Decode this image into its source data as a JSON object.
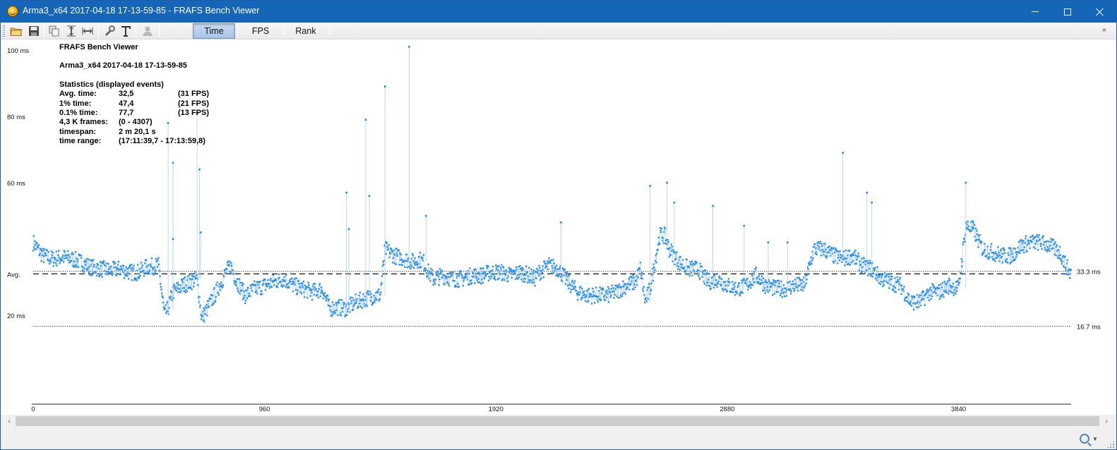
{
  "window": {
    "title": "Arma3_x64 2017-04-18 17-13-59-85 - FRAFS Bench Viewer"
  },
  "toolbar": {
    "icons": [
      "open-folder-icon",
      "save-icon",
      "copy-icon",
      "fit-vertical-icon",
      "fit-horizontal-icon",
      "settings-wrench-icon",
      "text-icon",
      "user-icon"
    ],
    "tabs": [
      {
        "label": "Time",
        "active": true
      },
      {
        "label": "FPS",
        "active": false
      },
      {
        "label": "Rank",
        "active": false
      }
    ]
  },
  "stats": {
    "app_title": "FRAFS Bench Viewer",
    "session": "Arma3_x64 2017-04-18 17-13-59-85",
    "heading": "Statistics (displayed events)",
    "rows": [
      {
        "label": "Avg. time:",
        "value": "32,5",
        "extra": "(31 FPS)"
      },
      {
        "label": "1% time:",
        "value": "47,4",
        "extra": "(21 FPS)"
      },
      {
        "label": "0.1% time:",
        "value": "77,7",
        "extra": "(13 FPS)"
      },
      {
        "label": "4,3 K frames:",
        "value": "(0 - 4307)",
        "extra": ""
      },
      {
        "label": "timespan:",
        "value": "2 m 20,1 s",
        "extra": ""
      },
      {
        "label": "time range:",
        "value": "(17:11:39,7 - 17:13:59,8)",
        "extra": ""
      }
    ]
  },
  "chart_data": {
    "type": "scatter",
    "title": "",
    "xlabel": "",
    "ylabel": "",
    "xlim": [
      0,
      4307
    ],
    "ylim": [
      0,
      102
    ],
    "y_tick_labels": [
      "100 ms",
      "80 ms",
      "60 ms",
      "Avg.",
      "20 ms"
    ],
    "y_tick_values": [
      100,
      80,
      60,
      32.5,
      20
    ],
    "x_tick_labels": [
      "0",
      "960",
      "1920",
      "2880",
      "3840"
    ],
    "x_tick_values": [
      0,
      960,
      1920,
      2880,
      3840
    ],
    "average": 32.5,
    "reference_lines": [
      {
        "label": "33.3 ms",
        "value": 33.3
      },
      {
        "label": "16.7 ms",
        "value": 16.7
      }
    ],
    "series_color": "#1e88e5",
    "series": [
      {
        "points": [
          [
            0,
            42
          ],
          [
            40,
            38
          ],
          [
            80,
            37
          ],
          [
            120,
            37.5
          ],
          [
            160,
            37
          ],
          [
            200,
            36
          ],
          [
            240,
            34.5
          ],
          [
            280,
            34
          ],
          [
            320,
            33.5
          ],
          [
            360,
            34
          ],
          [
            400,
            33
          ],
          [
            440,
            33
          ],
          [
            470,
            34.5
          ],
          [
            520,
            35
          ],
          [
            545,
            20
          ],
          [
            560,
            22
          ],
          [
            580,
            27
          ],
          [
            620,
            29
          ],
          [
            650,
            30
          ],
          [
            680,
            31
          ],
          [
            700,
            19
          ],
          [
            730,
            23
          ],
          [
            760,
            27
          ],
          [
            800,
            33
          ],
          [
            820,
            35
          ],
          [
            840,
            31
          ],
          [
            880,
            26
          ],
          [
            920,
            28
          ],
          [
            960,
            29
          ],
          [
            1000,
            30
          ],
          [
            1040,
            31
          ],
          [
            1080,
            29
          ],
          [
            1120,
            28
          ],
          [
            1160,
            27
          ],
          [
            1200,
            28
          ],
          [
            1230,
            22
          ],
          [
            1260,
            22.5
          ],
          [
            1300,
            22
          ],
          [
            1340,
            24
          ],
          [
            1380,
            25
          ],
          [
            1420,
            26
          ],
          [
            1440,
            26
          ],
          [
            1460,
            40
          ],
          [
            1500,
            38
          ],
          [
            1540,
            37
          ],
          [
            1580,
            36
          ],
          [
            1600,
            37
          ],
          [
            1620,
            36
          ],
          [
            1640,
            33
          ],
          [
            1660,
            31
          ],
          [
            1700,
            32
          ],
          [
            1740,
            31
          ],
          [
            1780,
            31
          ],
          [
            1820,
            32
          ],
          [
            1860,
            32
          ],
          [
            1900,
            33
          ],
          [
            1940,
            33
          ],
          [
            1980,
            32
          ],
          [
            2020,
            33
          ],
          [
            2060,
            32
          ],
          [
            2080,
            31
          ],
          [
            2100,
            33
          ],
          [
            2140,
            35
          ],
          [
            2180,
            34
          ],
          [
            2220,
            30
          ],
          [
            2260,
            27
          ],
          [
            2300,
            26
          ],
          [
            2340,
            26
          ],
          [
            2380,
            26
          ],
          [
            2420,
            27
          ],
          [
            2460,
            29
          ],
          [
            2500,
            30
          ],
          [
            2520,
            34
          ],
          [
            2540,
            24
          ],
          [
            2560,
            28
          ],
          [
            2600,
            44
          ],
          [
            2620,
            44
          ],
          [
            2640,
            40
          ],
          [
            2680,
            36
          ],
          [
            2720,
            34
          ],
          [
            2760,
            34
          ],
          [
            2800,
            30
          ],
          [
            2840,
            31
          ],
          [
            2880,
            29
          ],
          [
            2920,
            28
          ],
          [
            2960,
            29
          ],
          [
            3000,
            32
          ],
          [
            3040,
            29
          ],
          [
            3080,
            28
          ],
          [
            3120,
            28
          ],
          [
            3160,
            29
          ],
          [
            3200,
            29
          ],
          [
            3240,
            40
          ],
          [
            3280,
            40
          ],
          [
            3320,
            38
          ],
          [
            3360,
            37
          ],
          [
            3400,
            38
          ],
          [
            3440,
            35
          ],
          [
            3480,
            34
          ],
          [
            3520,
            31
          ],
          [
            3560,
            30
          ],
          [
            3600,
            29
          ],
          [
            3640,
            24
          ],
          [
            3680,
            24
          ],
          [
            3720,
            27
          ],
          [
            3760,
            27
          ],
          [
            3800,
            29
          ],
          [
            3840,
            28
          ],
          [
            3870,
            47
          ],
          [
            3900,
            46
          ],
          [
            3920,
            43
          ],
          [
            3940,
            40
          ],
          [
            3980,
            39
          ],
          [
            4020,
            38
          ],
          [
            4060,
            38
          ],
          [
            4100,
            41
          ],
          [
            4140,
            42
          ],
          [
            4180,
            42
          ],
          [
            4220,
            41
          ],
          [
            4260,
            39
          ],
          [
            4300,
            33
          ]
        ],
        "spikes": [
          [
            560,
            78
          ],
          [
            580,
            66
          ],
          [
            580,
            43
          ],
          [
            680,
            81
          ],
          [
            690,
            64
          ],
          [
            695,
            45
          ],
          [
            1300,
            57
          ],
          [
            1310,
            46
          ],
          [
            1380,
            79
          ],
          [
            1395,
            56
          ],
          [
            1460,
            89
          ],
          [
            1560,
            101
          ],
          [
            1630,
            50
          ],
          [
            2190,
            48
          ],
          [
            2560,
            59
          ],
          [
            2630,
            60
          ],
          [
            2660,
            54
          ],
          [
            2820,
            53
          ],
          [
            2950,
            47
          ],
          [
            3050,
            42
          ],
          [
            3130,
            42
          ],
          [
            3360,
            69
          ],
          [
            3460,
            57
          ],
          [
            3480,
            54
          ],
          [
            3870,
            60
          ]
        ]
      }
    ]
  },
  "scrollbar": {
    "left_arrow": "‹",
    "right_arrow": "›"
  },
  "statusbar": {
    "zoom_icon": "zoom-icon"
  }
}
